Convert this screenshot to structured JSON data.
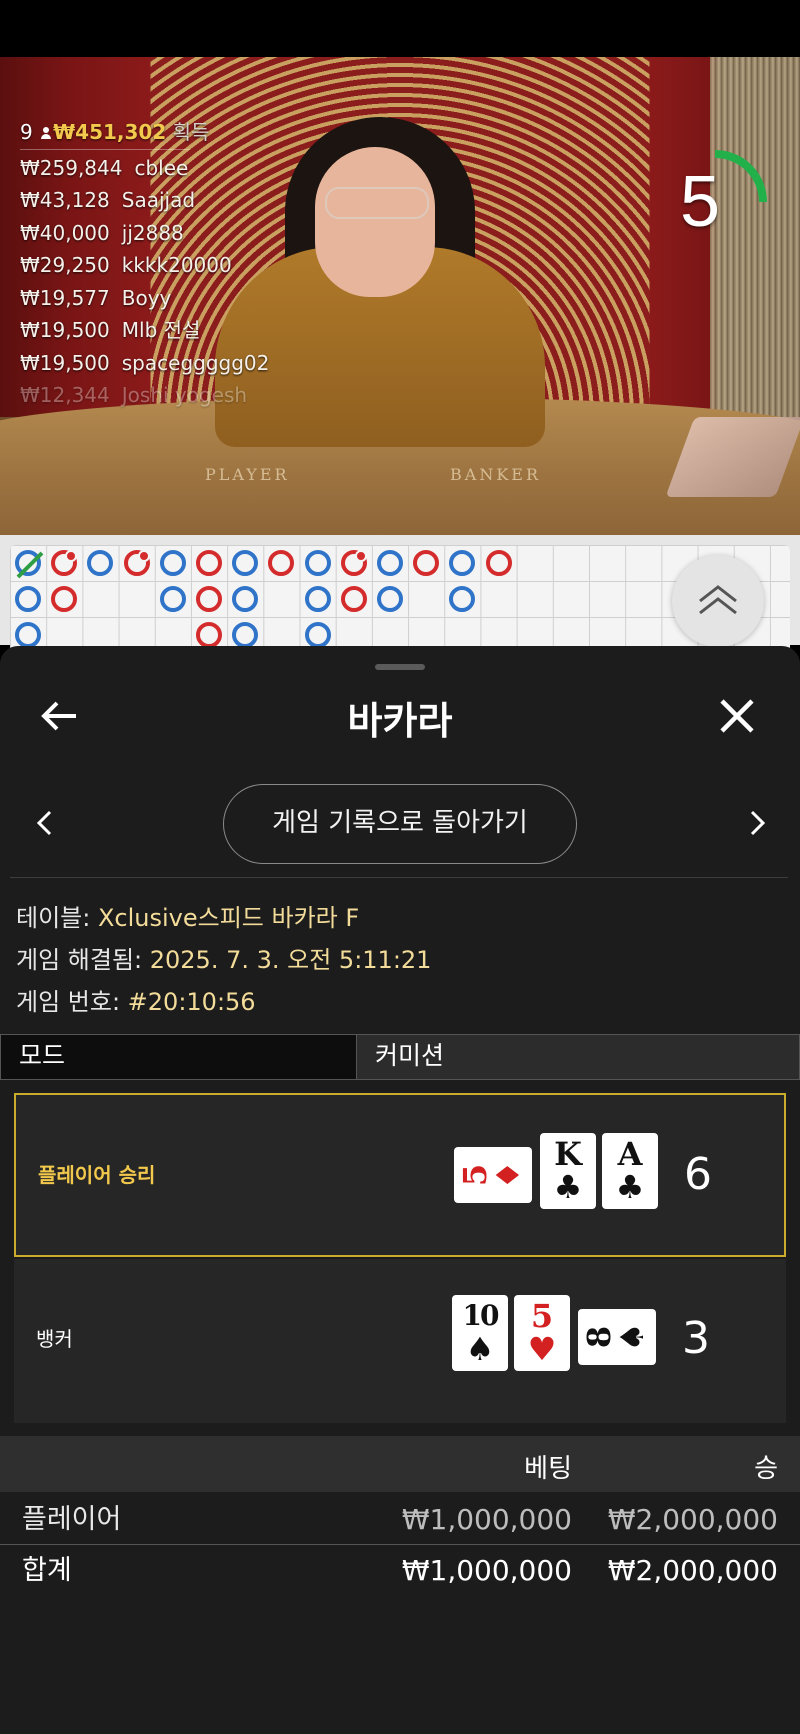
{
  "leaderboard": {
    "player_count": "9",
    "total_amount": "₩451,302",
    "total_suffix": "획득",
    "rows": [
      {
        "amount": "₩259,844",
        "name": "cblee"
      },
      {
        "amount": "₩43,128",
        "name": "Saajjad"
      },
      {
        "amount": "₩40,000",
        "name": "jj2888"
      },
      {
        "amount": "₩29,250",
        "name": "kkkk20000"
      },
      {
        "amount": "₩19,577",
        "name": "Boyy"
      },
      {
        "amount": "₩19,500",
        "name": "Mlb 전설"
      },
      {
        "amount": "₩19,500",
        "name": "spaceggggg02"
      },
      {
        "amount": "₩12,344",
        "name": "Joshi yogesh"
      }
    ]
  },
  "table_felt": {
    "player": "PLAYER",
    "banker": "BANKER"
  },
  "timer": {
    "seconds": "5",
    "remaining_fraction": 0.25,
    "color": "#22b04b"
  },
  "colors": {
    "player": "#2f74c8",
    "banker": "#d42c2c",
    "tie": "#2f9e45",
    "accent": "#c9ab2e",
    "value_text": "#f3dc9a"
  },
  "bead_road": {
    "columns": [
      [
        "P-tie",
        "P",
        "P"
      ],
      [
        "B-pair",
        "B"
      ],
      [
        "P"
      ],
      [
        "B-pair"
      ],
      [
        "P",
        "P"
      ],
      [
        "B",
        "B",
        "B"
      ],
      [
        "P",
        "P",
        "P"
      ],
      [
        "B"
      ],
      [
        "P",
        "P",
        "P"
      ],
      [
        "B-pair",
        "B"
      ],
      [
        "P",
        "P"
      ],
      [
        "B"
      ],
      [
        "P",
        "P"
      ],
      [
        "B"
      ]
    ]
  },
  "sheet": {
    "title": "바카라",
    "back_icon": "arrow-left-icon",
    "close_icon": "close-icon",
    "history_button": "게임 기록으로 돌아가기"
  },
  "info": {
    "table_label": "테이블: ",
    "table_value": "Xclusive스피드 바카라 F",
    "resolved_label": "게임 해결됨: ",
    "resolved_value": "2025. 7. 3. 오전 5:11:21",
    "number_label": "게임 번호: ",
    "number_value": "#20:10:56"
  },
  "tabs": {
    "mode": "모드",
    "commission": "커미션"
  },
  "results": {
    "player": {
      "label": "플레이어 승리",
      "score": "6",
      "cards": [
        {
          "rank": "5",
          "suit": "♦",
          "color": "red",
          "orientation": "horizontal"
        },
        {
          "rank": "K",
          "suit": "♣",
          "color": "black",
          "orientation": "vertical"
        },
        {
          "rank": "A",
          "suit": "♣",
          "color": "black",
          "orientation": "vertical"
        }
      ]
    },
    "banker": {
      "label": "뱅커",
      "score": "3",
      "cards": [
        {
          "rank": "10",
          "suit": "♠",
          "color": "black",
          "orientation": "vertical"
        },
        {
          "rank": "5",
          "suit": "♥",
          "color": "red",
          "orientation": "vertical"
        },
        {
          "rank": "8",
          "suit": "♠",
          "color": "black",
          "orientation": "horizontal"
        }
      ]
    }
  },
  "bets": {
    "headers": {
      "bet": "베팅",
      "win": "승"
    },
    "rows": [
      {
        "label": "플레이어",
        "bet": "₩1,000,000",
        "win": "₩2,000,000"
      },
      {
        "label": "합계",
        "bet": "₩1,000,000",
        "win": "₩2,000,000"
      }
    ]
  }
}
